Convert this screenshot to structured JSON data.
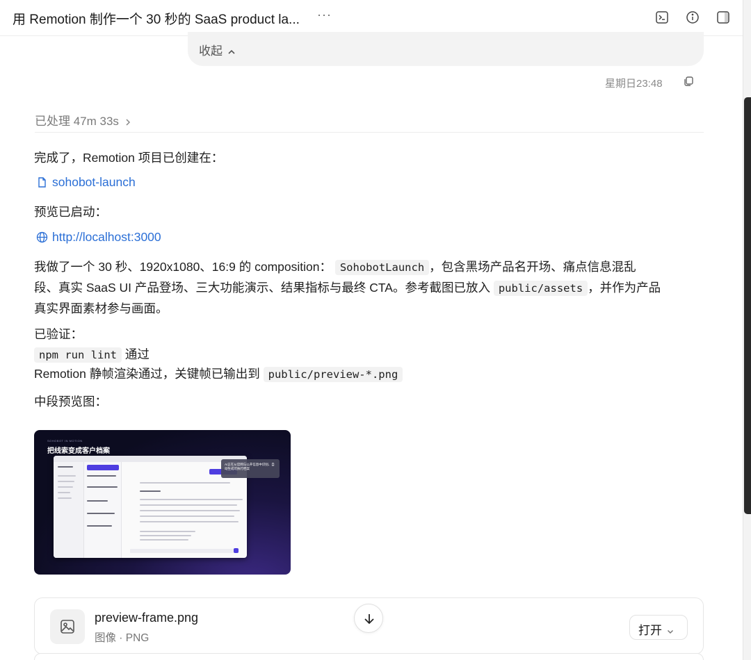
{
  "header": {
    "title": "用 Remotion 制作一个 30 秒的 SaaS product la...",
    "more_label": "···",
    "icons": [
      "terminal-icon",
      "info-icon",
      "sidebar-toggle-icon"
    ]
  },
  "message": {
    "collapse_label": "收起",
    "timestamp": "星期日23:48"
  },
  "response": {
    "processed_label": "已处理 47m 33s",
    "intro": "完成了，Remotion 项目已创建在：",
    "project_link": "sohobot-launch",
    "preview_intro": "预览已启动：",
    "preview_link": "http://localhost:3000",
    "para1_a": "我做了一个 30 秒、1920x1080、16:9 的 composition：",
    "para1_code": "SohobotLaunch",
    "para1_b": "，包含黑场产品名开场、痛点信息混乱",
    "para1_c": "段、真实 SaaS UI 产品登场、三大功能演示、结果指标与最终 CTA。参考截图已放入",
    "para1_code2": "public/assets",
    "para1_d": "，并作为产品",
    "para1_e": "真实界面素材参与画面。",
    "verified_label": "已验证：",
    "verify1_code": "npm run lint",
    "verify1_text": "通过",
    "verify2_text": "Remotion 静帧渲染通过，关键帧已输出到",
    "verify2_code": "public/preview-*.png",
    "midpreview_label": "中段预览图："
  },
  "preview_image": {
    "subtitle": "SOHOBOT IN MOTION",
    "title": "把线索变成客户档案",
    "tooltip": "AI正在从官网与公开信息中识别、自动生成可执行档案"
  },
  "attachment": {
    "file_name": "preview-frame.png",
    "file_meta": "图像 · PNG",
    "open_label": "打开"
  }
}
